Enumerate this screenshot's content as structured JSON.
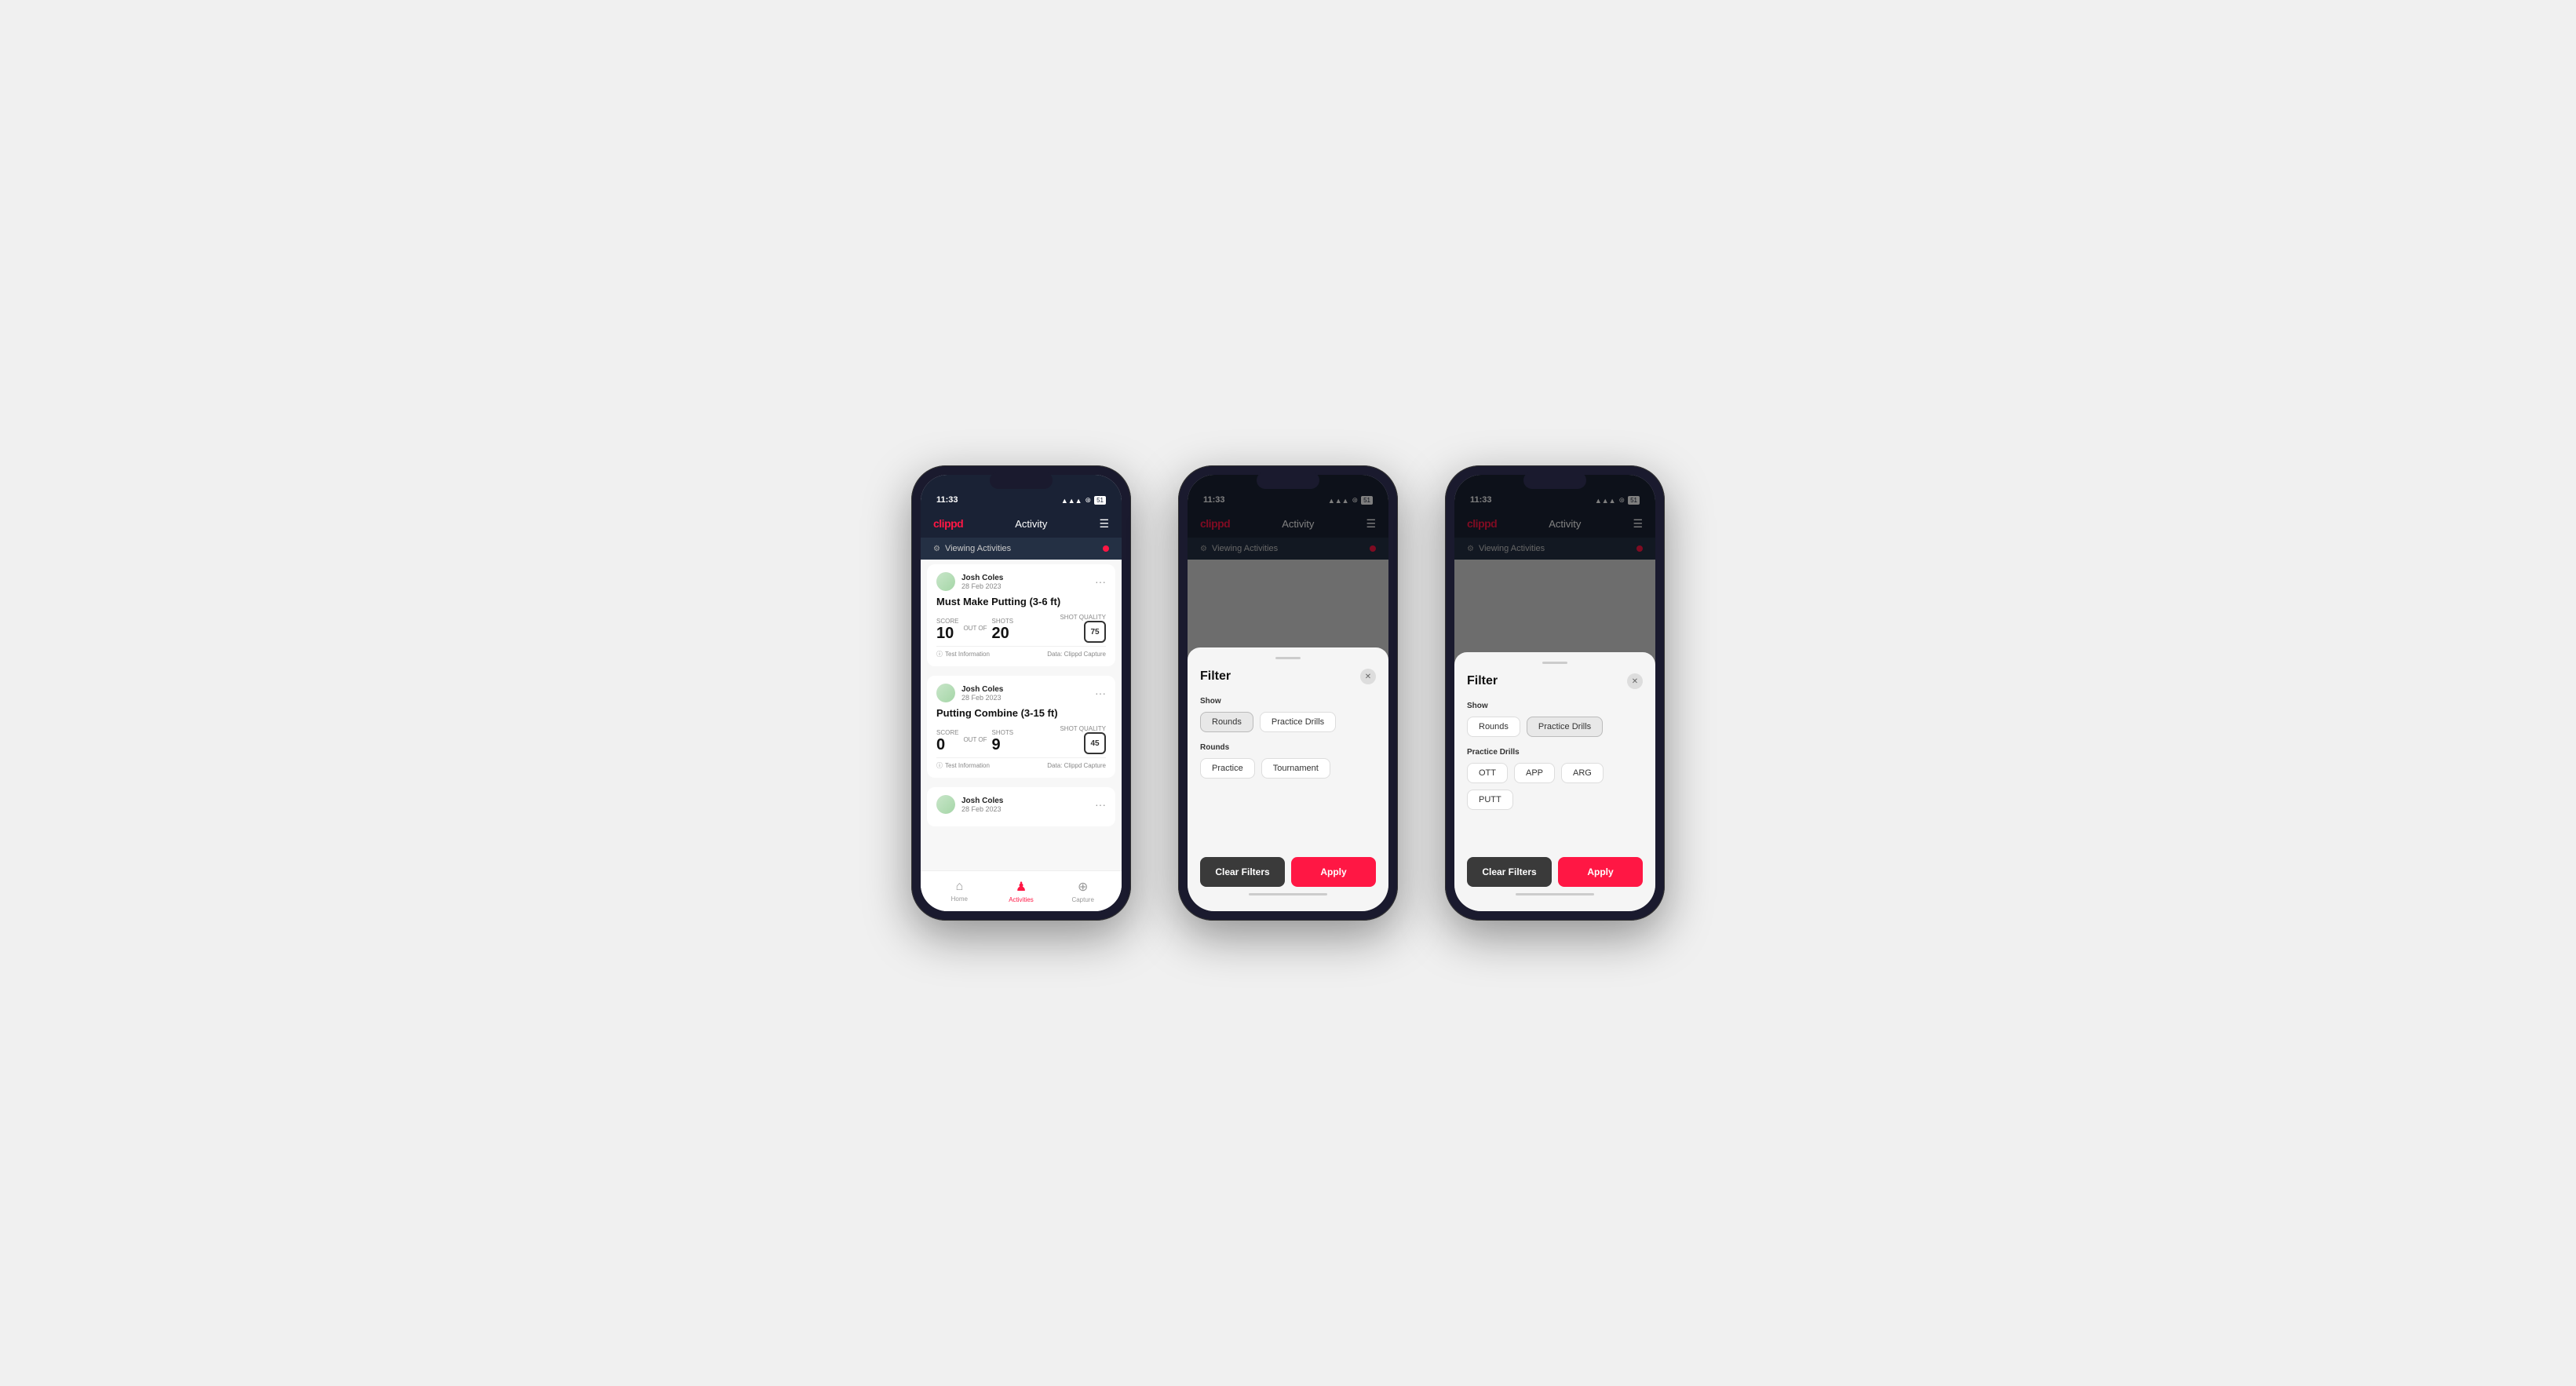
{
  "app": {
    "name": "clippd",
    "nav_title": "Activity",
    "status_time": "11:33",
    "status_icons": "▲ ▼ ⊞"
  },
  "viewing_bar": {
    "text": "Viewing Activities",
    "icon": "⚙"
  },
  "phone1": {
    "cards": [
      {
        "user": "Josh Coles",
        "date": "28 Feb 2023",
        "title": "Must Make Putting (3-6 ft)",
        "score_label": "Score",
        "score_value": "10",
        "shots_label": "Shots",
        "shots_value": "20",
        "quality_label": "Shot Quality",
        "quality_value": "75",
        "footer_left": "Test Information",
        "footer_right": "Data: Clippd Capture"
      },
      {
        "user": "Josh Coles",
        "date": "28 Feb 2023",
        "title": "Putting Combine (3-15 ft)",
        "score_label": "Score",
        "score_value": "0",
        "shots_label": "Shots",
        "shots_value": "9",
        "quality_label": "Shot Quality",
        "quality_value": "45",
        "footer_left": "Test Information",
        "footer_right": "Data: Clippd Capture"
      },
      {
        "user": "Josh Coles",
        "date": "28 Feb 2023",
        "title": "",
        "score_label": "",
        "score_value": "",
        "shots_label": "",
        "shots_value": "",
        "quality_label": "",
        "quality_value": "",
        "footer_left": "",
        "footer_right": ""
      }
    ],
    "tabs": [
      {
        "label": "Home",
        "icon": "⌂",
        "active": false
      },
      {
        "label": "Activities",
        "icon": "♟",
        "active": true
      },
      {
        "label": "Capture",
        "icon": "+",
        "active": false
      }
    ]
  },
  "phone2": {
    "filter": {
      "title": "Filter",
      "show_label": "Show",
      "show_options": [
        {
          "label": "Rounds",
          "selected": true
        },
        {
          "label": "Practice Drills",
          "selected": false
        }
      ],
      "rounds_label": "Rounds",
      "rounds_options": [
        {
          "label": "Practice",
          "selected": false
        },
        {
          "label": "Tournament",
          "selected": false
        }
      ],
      "clear_label": "Clear Filters",
      "apply_label": "Apply"
    }
  },
  "phone3": {
    "filter": {
      "title": "Filter",
      "show_label": "Show",
      "show_options": [
        {
          "label": "Rounds",
          "selected": false
        },
        {
          "label": "Practice Drills",
          "selected": true
        }
      ],
      "drills_label": "Practice Drills",
      "drills_options": [
        {
          "label": "OTT",
          "selected": false
        },
        {
          "label": "APP",
          "selected": false
        },
        {
          "label": "ARG",
          "selected": false
        },
        {
          "label": "PUTT",
          "selected": false
        }
      ],
      "clear_label": "Clear Filters",
      "apply_label": "Apply"
    }
  }
}
